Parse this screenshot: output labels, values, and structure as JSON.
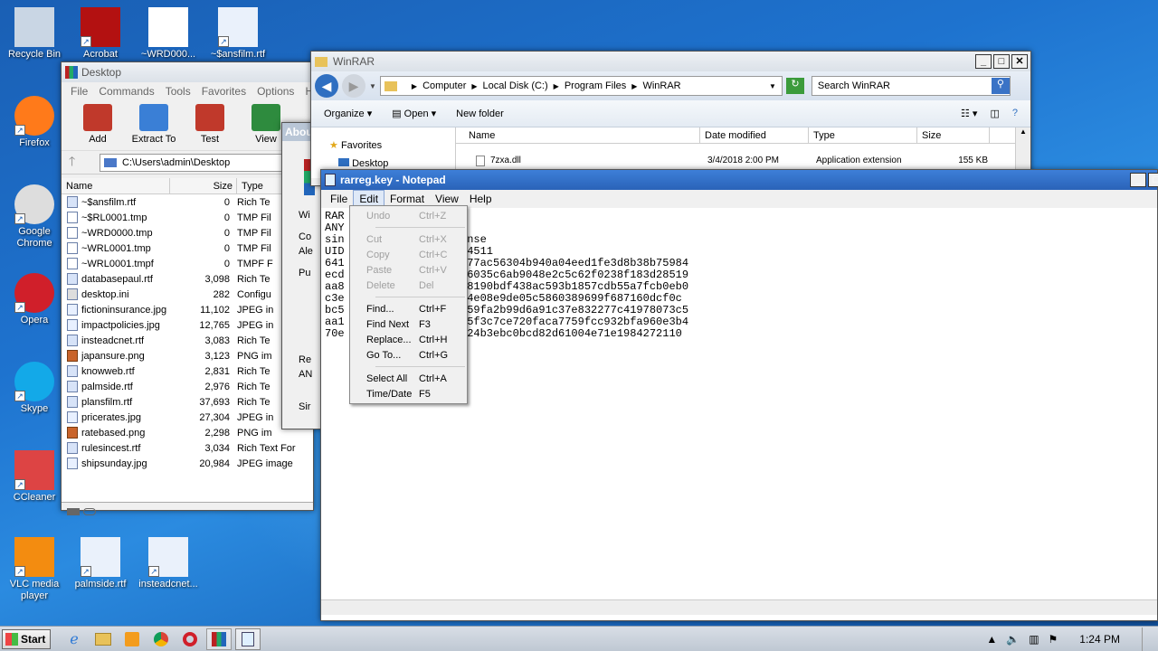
{
  "desktop": {
    "icons": [
      {
        "label": "Recycle Bin",
        "icon": "recycle-bin-icon"
      },
      {
        "label": "Acrobat",
        "icon": "acrobat-icon"
      },
      {
        "label": "~WRD000...",
        "icon": "file-icon"
      },
      {
        "label": "~$ansfilm.rtf",
        "icon": "word-doc-icon"
      },
      {
        "label": "Firefox",
        "icon": "firefox-icon"
      },
      {
        "label": "Google Chrome",
        "icon": "chrome-icon"
      },
      {
        "label": "Opera",
        "icon": "opera-icon"
      },
      {
        "label": "Skype",
        "icon": "skype-icon"
      },
      {
        "label": "CCleaner",
        "icon": "ccleaner-icon"
      },
      {
        "label": "VLC media player",
        "icon": "vlc-icon"
      },
      {
        "label": "palmside.rtf",
        "icon": "word-doc-icon"
      },
      {
        "label": "insteadcnet...",
        "icon": "word-doc-icon"
      }
    ]
  },
  "explorer": {
    "title": "Desktop",
    "menu": [
      "File",
      "Commands",
      "Tools",
      "Favorites",
      "Options",
      "Help"
    ],
    "toolbar": [
      "Add",
      "Extract To",
      "Test",
      "View"
    ],
    "path": "C:\\Users\\admin\\Desktop",
    "columns": [
      "Name",
      "Size",
      "Type"
    ],
    "files": [
      {
        "name": "~$ansfilm.rtf",
        "size": "0",
        "type": "Rich Te",
        "kind": "rtf"
      },
      {
        "name": "~$RL0001.tmp",
        "size": "0",
        "type": "TMP Fil",
        "kind": "tmp"
      },
      {
        "name": "~WRD0000.tmp",
        "size": "0",
        "type": "TMP Fil",
        "kind": "tmp"
      },
      {
        "name": "~WRL0001.tmp",
        "size": "0",
        "type": "TMP Fil",
        "kind": "tmp"
      },
      {
        "name": "~WRL0001.tmpf",
        "size": "0",
        "type": "TMPF F",
        "kind": "tmp"
      },
      {
        "name": "databasepaul.rtf",
        "size": "3,098",
        "type": "Rich Te",
        "kind": "rtf"
      },
      {
        "name": "desktop.ini",
        "size": "282",
        "type": "Configu",
        "kind": "ini"
      },
      {
        "name": "fictioninsurance.jpg",
        "size": "11,102",
        "type": "JPEG in",
        "kind": "jpg"
      },
      {
        "name": "impactpolicies.jpg",
        "size": "12,765",
        "type": "JPEG in",
        "kind": "jpg"
      },
      {
        "name": "insteadcnet.rtf",
        "size": "3,083",
        "type": "Rich Te",
        "kind": "rtf"
      },
      {
        "name": "japansure.png",
        "size": "3,123",
        "type": "PNG im",
        "kind": "png"
      },
      {
        "name": "knowweb.rtf",
        "size": "2,831",
        "type": "Rich Te",
        "kind": "rtf"
      },
      {
        "name": "palmside.rtf",
        "size": "2,976",
        "type": "Rich Te",
        "kind": "rtf"
      },
      {
        "name": "plansfilm.rtf",
        "size": "37,693",
        "type": "Rich Te",
        "kind": "rtf"
      },
      {
        "name": "pricerates.jpg",
        "size": "27,304",
        "type": "JPEG in",
        "kind": "jpg"
      },
      {
        "name": "ratebased.png",
        "size": "2,298",
        "type": "PNG im",
        "kind": "png"
      },
      {
        "name": "rulesincest.rtf",
        "size": "3,034",
        "type": "Rich Text For",
        "kind": "rtf"
      },
      {
        "name": "shipsunday.jpg",
        "size": "20,984",
        "type": "JPEG image",
        "kind": "jpg"
      }
    ]
  },
  "about": {
    "title": "Abou",
    "lines": [
      "Wi",
      "Co",
      "Ale",
      "Pu",
      "Re",
      "AN",
      "Sir"
    ]
  },
  "winrar": {
    "title": "WinRAR",
    "breadcrumb": [
      "Computer",
      "Local Disk (C:)",
      "Program Files",
      "WinRAR"
    ],
    "search_placeholder": "Search WinRAR",
    "toolbar": {
      "organize": "Organize",
      "open": "Open",
      "new_folder": "New folder"
    },
    "columns": [
      "Name",
      "Date modified",
      "Type",
      "Size"
    ],
    "nav": [
      "Favorites",
      "Desktop"
    ],
    "row": {
      "name": "7zxa.dll",
      "date": "3/4/2018 2:00 PM",
      "type": "Application extension",
      "size": "155 KB"
    }
  },
  "notepad": {
    "title": "rarreg.key - Notepad",
    "menu": [
      "File",
      "Edit",
      "Format",
      "View",
      "Help"
    ],
    "lines": [
      {
        "pre": "RAR",
        "post": "a"
      },
      {
        "pre": "ANY",
        "post": ""
      },
      {
        "pre": "sin",
        "post": "ense"
      },
      {
        "pre": "UID",
        "post": "04511"
      },
      {
        "pre": "641",
        "post": "c77ac56304b940a04eed1fe3d8b38b75984"
      },
      {
        "pre": "ecd",
        "post": "56035c6ab9048e2c5c62f0238f183d28519"
      },
      {
        "pre": "aa8",
        "post": "28190bdf438ac593b1857cdb55a7fcb0eb0"
      },
      {
        "pre": "c3e",
        "post": "84e08e9de05c5860389699f687160dcf0c"
      },
      {
        "pre": "bc5",
        "post": "d59fa2b99d6a91c37e832277c41978073c5"
      },
      {
        "pre": "aa1",
        "post": "75f3c7ce720faca7759fcc932bfa960e3b4"
      },
      {
        "pre": "70e",
        "post": "a24b3ebc0bcd82d61004e71e1984272110"
      }
    ]
  },
  "edit_menu": {
    "items": [
      {
        "label": "Undo",
        "shortcut": "Ctrl+Z",
        "disabled": true
      },
      {
        "sep": true
      },
      {
        "label": "Cut",
        "shortcut": "Ctrl+X",
        "disabled": true
      },
      {
        "label": "Copy",
        "shortcut": "Ctrl+C",
        "disabled": true
      },
      {
        "label": "Paste",
        "shortcut": "Ctrl+V",
        "disabled": true
      },
      {
        "label": "Delete",
        "shortcut": "Del",
        "disabled": true
      },
      {
        "sep": true
      },
      {
        "label": "Find...",
        "shortcut": "Ctrl+F",
        "disabled": false
      },
      {
        "label": "Find Next",
        "shortcut": "F3",
        "disabled": false
      },
      {
        "label": "Replace...",
        "shortcut": "Ctrl+H",
        "disabled": false
      },
      {
        "label": "Go To...",
        "shortcut": "Ctrl+G",
        "disabled": false
      },
      {
        "sep": true
      },
      {
        "label": "Select All",
        "shortcut": "Ctrl+A",
        "disabled": false
      },
      {
        "label": "Time/Date",
        "shortcut": "F5",
        "disabled": false
      }
    ]
  },
  "taskbar": {
    "start": "Start",
    "clock": "1:24 PM"
  },
  "watermark": "ANY RUN"
}
